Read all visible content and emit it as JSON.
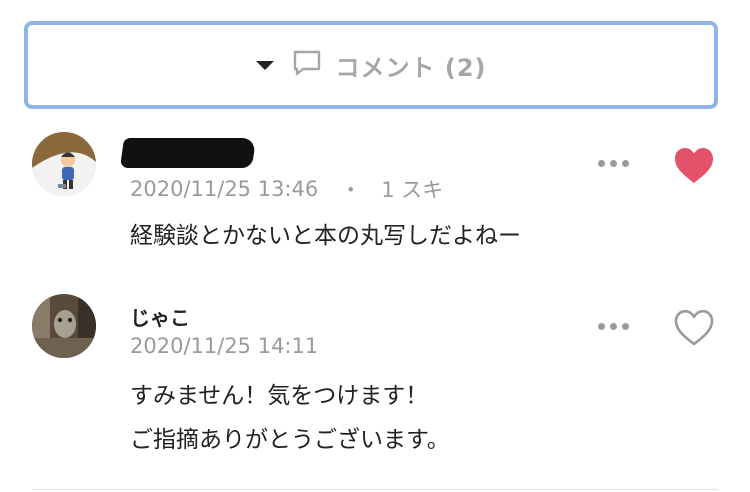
{
  "toggle": {
    "label": "コメント (2)"
  },
  "comments": [
    {
      "name": "",
      "timestamp": "2020/11/25 13:46",
      "separator": "・",
      "likes": "1 スキ",
      "body": [
        "経験談とかないと本の丸写しだよねー"
      ],
      "liked": true
    },
    {
      "name": "じゃこ",
      "timestamp": "2020/11/25 14:11",
      "body": [
        "すみません！気をつけます！",
        "ご指摘ありがとうございます。"
      ],
      "liked": false
    }
  ],
  "colors": {
    "accent_border": "#8fb5e8",
    "heart_liked": "#e5506a",
    "muted": "#9a9a9a"
  }
}
